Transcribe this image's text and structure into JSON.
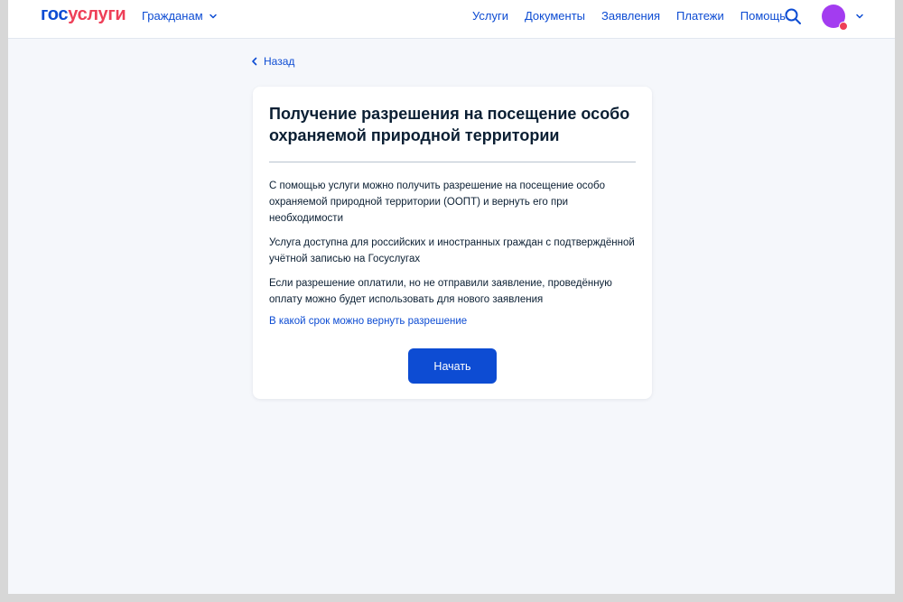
{
  "header": {
    "logo_part1": "гос",
    "logo_part2": "услуги",
    "audience": "Гражданам",
    "nav": [
      "Услуги",
      "Документы",
      "Заявления",
      "Платежи",
      "Помощь"
    ],
    "search_icon": "search-icon",
    "avatar_color": "#a33cf0",
    "notification_dot_color": "#ee3f58"
  },
  "back": {
    "label": "Назад"
  },
  "card": {
    "title": "Получение разрешения на посещение особо охраняемой природной территории",
    "paragraphs": [
      "С помощью услуги можно получить разрешение на посещение особо охраняемой природной территории (ООПТ) и вернуть его при необходимости",
      "Услуга доступна для российских и иностранных граждан с подтверждённой учётной записью на Госуслугах",
      "Если разрешение оплатили, но не отправили заявление, проведённую оплату можно будет использовать для нового заявления"
    ],
    "link": "В какой срок можно вернуть разрешение",
    "start_button": "Начать"
  },
  "colors": {
    "accent": "#0d4cd3",
    "brand_red": "#ee3f58",
    "text": "#0b1f33",
    "page_bg": "#f5f7fb"
  }
}
